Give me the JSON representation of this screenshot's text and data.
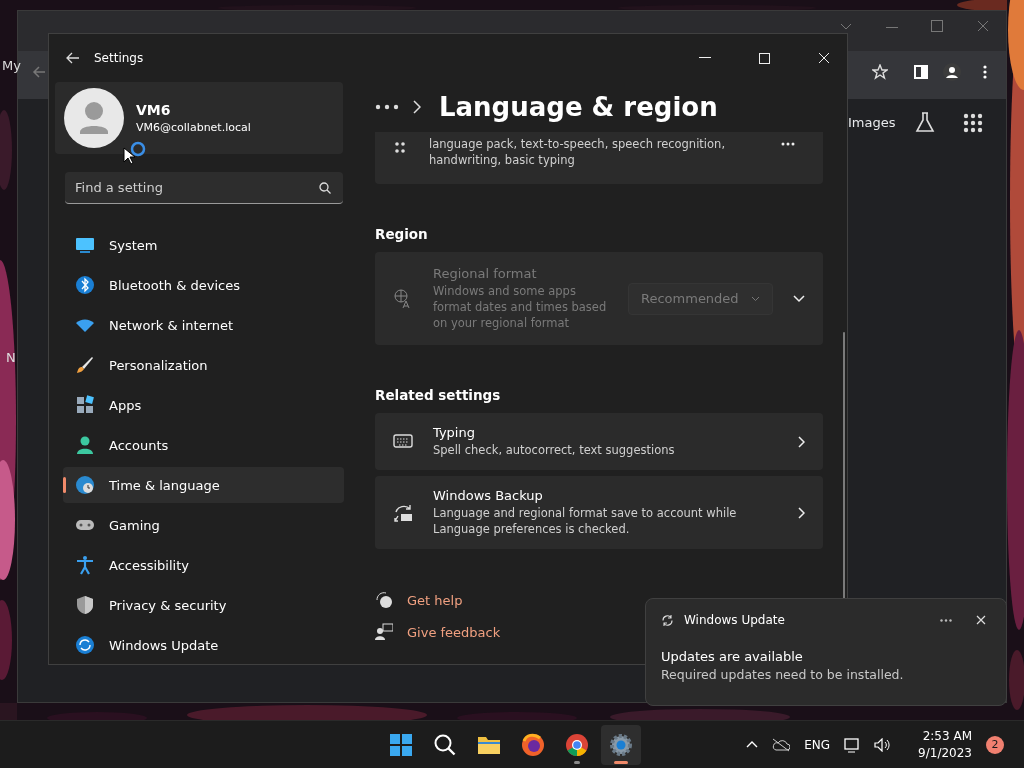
{
  "browser_window": {
    "left_edge_texts": [
      "My",
      "N"
    ],
    "toolbar_link": "Images"
  },
  "settings_window": {
    "title": "Settings",
    "profile": {
      "name": "VM6",
      "email": "VM6@collabnet.local"
    },
    "search": {
      "placeholder": "Find a setting"
    },
    "nav": [
      {
        "label": "System",
        "selected": false
      },
      {
        "label": "Bluetooth & devices",
        "selected": false
      },
      {
        "label": "Network & internet",
        "selected": false
      },
      {
        "label": "Personalization",
        "selected": false
      },
      {
        "label": "Apps",
        "selected": false
      },
      {
        "label": "Accounts",
        "selected": false
      },
      {
        "label": "Time & language",
        "selected": true
      },
      {
        "label": "Gaming",
        "selected": false
      },
      {
        "label": "Accessibility",
        "selected": false
      },
      {
        "label": "Privacy & security",
        "selected": false
      },
      {
        "label": "Windows Update",
        "selected": false
      }
    ],
    "page_title": "Language & region",
    "partial_card": {
      "description": "language pack, text-to-speech, speech recognition, handwriting, basic typing"
    },
    "sections": [
      {
        "heading": "Region",
        "cards": [
          {
            "kind": "dropdown",
            "title": "Regional format",
            "description": "Windows and some apps format dates and times based on your regional format",
            "disabled": true,
            "value": "Recommended"
          }
        ]
      },
      {
        "heading": "Related settings",
        "cards": [
          {
            "kind": "link",
            "title": "Typing",
            "description": "Spell check, autocorrect, text suggestions"
          },
          {
            "kind": "link",
            "title": "Windows Backup",
            "description": "Language and regional format save to account while Language preferences is checked."
          }
        ]
      }
    ],
    "help_links": [
      "Get help",
      "Give feedback"
    ]
  },
  "notification": {
    "app": "Windows Update",
    "title": "Updates are available",
    "body": "Required updates need to be installed."
  },
  "taskbar": {
    "apps": [
      {
        "running": false,
        "selected": false
      },
      {
        "running": false,
        "selected": false
      },
      {
        "running": false,
        "selected": false
      },
      {
        "running": false,
        "selected": false
      },
      {
        "running": true,
        "selected": false
      },
      {
        "running": true,
        "selected": true
      }
    ],
    "tray": {
      "language": "ENG",
      "time": "2:53 AM",
      "date": "9/1/2023",
      "badge": "2"
    }
  }
}
